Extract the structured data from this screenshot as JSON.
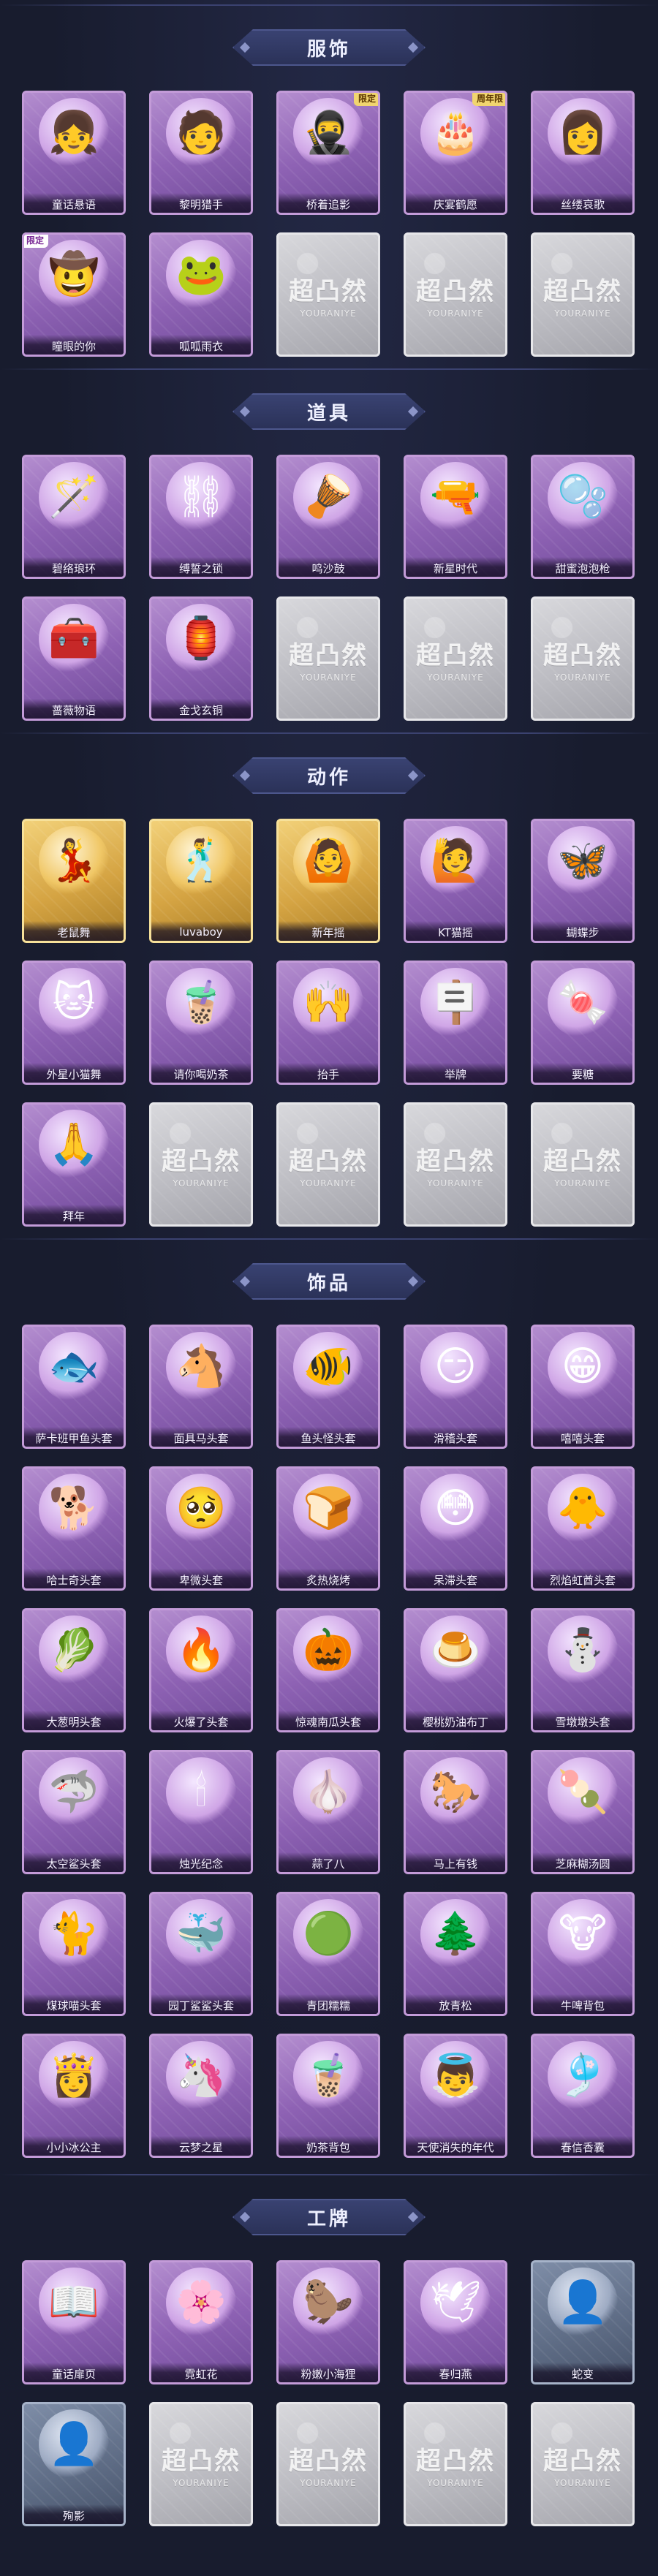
{
  "locked_watermark": {
    "title": "超凸然",
    "subtitle": "YOURANIYE"
  },
  "sections": [
    {
      "title": "服饰",
      "items": [
        {
          "label": "童话悬语",
          "style": "purple",
          "icon": "portrait-girl-icon",
          "glyph": "👧"
        },
        {
          "label": "黎明猎手",
          "style": "purple",
          "icon": "portrait-hunter-icon",
          "glyph": "🧑"
        },
        {
          "label": "桥着追影",
          "style": "purple",
          "icon": "portrait-ninja-icon",
          "glyph": "🥷",
          "badge": "限定"
        },
        {
          "label": "庆宴鹤愿",
          "style": "purple",
          "icon": "portrait-feast-icon",
          "glyph": "🎂",
          "badge": "周年限"
        },
        {
          "label": "丝缕哀歌",
          "style": "purple",
          "icon": "portrait-lady-icon",
          "glyph": "👩"
        },
        {
          "label": "瞳眼的你",
          "style": "purple",
          "icon": "portrait-cowboy-icon",
          "glyph": "🤠",
          "badge_left": "限定"
        },
        {
          "label": "呱呱雨衣",
          "style": "purple",
          "icon": "portrait-frog-girl-icon",
          "glyph": "🐸"
        },
        {
          "label": "",
          "style": "gray",
          "icon": "locked-icon"
        },
        {
          "label": "",
          "style": "gray",
          "icon": "locked-icon"
        },
        {
          "label": "",
          "style": "gray",
          "icon": "locked-icon"
        }
      ]
    },
    {
      "title": "道具",
      "items": [
        {
          "label": "碧络琅环",
          "style": "purple",
          "icon": "staff-icon",
          "glyph": "🪄"
        },
        {
          "label": "缚誓之锁",
          "style": "purple",
          "icon": "chain-icon",
          "glyph": "⛓"
        },
        {
          "label": "鸣沙鼓",
          "style": "purple",
          "icon": "drum-icon",
          "glyph": "🪘"
        },
        {
          "label": "新星时代",
          "style": "purple",
          "icon": "revolver-icon",
          "glyph": "🔫"
        },
        {
          "label": "甜蜜泡泡枪",
          "style": "purple",
          "icon": "bubble-gun-icon",
          "glyph": "🫧"
        },
        {
          "label": "蔷薇物语",
          "style": "purple",
          "icon": "medkit-icon",
          "glyph": "🧰"
        },
        {
          "label": "金戈玄铜",
          "style": "purple",
          "icon": "lantern-icon",
          "glyph": "🏮"
        },
        {
          "label": "",
          "style": "gray",
          "icon": "locked-icon"
        },
        {
          "label": "",
          "style": "gray",
          "icon": "locked-icon"
        },
        {
          "label": "",
          "style": "gray",
          "icon": "locked-icon"
        }
      ]
    },
    {
      "title": "动作",
      "items": [
        {
          "label": "老鼠舞",
          "style": "gold",
          "icon": "dance-pose-icon",
          "glyph": "💃"
        },
        {
          "label": "luvaboy",
          "style": "gold",
          "icon": "dance-pose-icon",
          "glyph": "🕺"
        },
        {
          "label": "新年摇",
          "style": "gold",
          "icon": "dance-pose-icon",
          "glyph": "🙆"
        },
        {
          "label": "KT猫摇",
          "style": "purple",
          "icon": "pose-icon",
          "glyph": "🙋"
        },
        {
          "label": "蝴蝶步",
          "style": "purple",
          "icon": "pose-icon",
          "glyph": "🦋"
        },
        {
          "label": "外星小猫舞",
          "style": "purple",
          "icon": "pose-icon",
          "glyph": "🐱"
        },
        {
          "label": "请你喝奶茶",
          "style": "purple",
          "icon": "pose-icon",
          "glyph": "🧋"
        },
        {
          "label": "抬手",
          "style": "purple",
          "icon": "pose-icon",
          "glyph": "🙌"
        },
        {
          "label": "举牌",
          "style": "purple",
          "icon": "pose-icon",
          "glyph": "🪧"
        },
        {
          "label": "要糖",
          "style": "purple",
          "icon": "pose-icon",
          "glyph": "🍬"
        },
        {
          "label": "拜年",
          "style": "purple",
          "icon": "pose-icon",
          "glyph": "🙏"
        },
        {
          "label": "",
          "style": "gray",
          "icon": "locked-icon"
        },
        {
          "label": "",
          "style": "gray",
          "icon": "locked-icon"
        },
        {
          "label": "",
          "style": "gray",
          "icon": "locked-icon"
        },
        {
          "label": "",
          "style": "gray",
          "icon": "locked-icon"
        }
      ]
    },
    {
      "title": "饰品",
      "items": [
        {
          "label": "萨卡班甲鱼头套",
          "style": "purple",
          "icon": "fish-head-icon",
          "glyph": "🐟"
        },
        {
          "label": "面具马头套",
          "style": "purple",
          "icon": "horse-head-icon",
          "glyph": "🐴"
        },
        {
          "label": "鱼头怪头套",
          "style": "purple",
          "icon": "fish-monster-icon",
          "glyph": "🐠"
        },
        {
          "label": "滑稽头套",
          "style": "purple",
          "icon": "smile-head-icon",
          "glyph": "😏"
        },
        {
          "label": "嘻嘻头套",
          "style": "purple",
          "icon": "grin-head-icon",
          "glyph": "😁"
        },
        {
          "label": "哈士奇头套",
          "style": "purple",
          "icon": "dog-head-icon",
          "glyph": "🐕"
        },
        {
          "label": "卑微头套",
          "style": "purple",
          "icon": "shy-head-icon",
          "glyph": "🥺"
        },
        {
          "label": "炙热烧烤",
          "style": "purple",
          "icon": "toast-head-icon",
          "glyph": "🍞"
        },
        {
          "label": "呆滞头套",
          "style": "purple",
          "icon": "dazed-head-icon",
          "glyph": "😳"
        },
        {
          "label": "烈焰虹酋头套",
          "style": "purple",
          "icon": "chick-head-icon",
          "glyph": "🐥"
        },
        {
          "label": "大葱明头套",
          "style": "purple",
          "icon": "sprout-head-icon",
          "glyph": "🥬"
        },
        {
          "label": "火爆了头套",
          "style": "purple",
          "icon": "flame-head-icon",
          "glyph": "🔥"
        },
        {
          "label": "惊魂南瓜头套",
          "style": "purple",
          "icon": "pumpkin-head-icon",
          "glyph": "🎃"
        },
        {
          "label": "樱桃奶油布丁",
          "style": "purple",
          "icon": "pudding-head-icon",
          "glyph": "🍮"
        },
        {
          "label": "雪墩墩头套",
          "style": "purple",
          "icon": "snowman-head-icon",
          "glyph": "⛄"
        },
        {
          "label": "太空鲨头套",
          "style": "purple",
          "icon": "shark-head-icon",
          "glyph": "🦈"
        },
        {
          "label": "烛光纪念",
          "style": "purple",
          "icon": "candle-head-icon",
          "glyph": "🕯"
        },
        {
          "label": "蒜了八",
          "style": "purple",
          "icon": "garlic-head-icon",
          "glyph": "🧄"
        },
        {
          "label": "马上有钱",
          "style": "purple",
          "icon": "horse-toy-icon",
          "glyph": "🐎"
        },
        {
          "label": "芝麻糊汤圆",
          "style": "purple",
          "icon": "dumpling-head-icon",
          "glyph": "🍡"
        },
        {
          "label": "煤球喵头套",
          "style": "purple",
          "icon": "cat-head-icon",
          "glyph": "🐈"
        },
        {
          "label": "园丁鲨鲨头套",
          "style": "purple",
          "icon": "gardener-shark-icon",
          "glyph": "🐳"
        },
        {
          "label": "青团糯糯",
          "style": "purple",
          "icon": "qingtuan-head-icon",
          "glyph": "🟢"
        },
        {
          "label": "放青松",
          "style": "purple",
          "icon": "pine-tree-icon",
          "glyph": "🌲"
        },
        {
          "label": "牛啤背包",
          "style": "purple",
          "icon": "cow-backpack-icon",
          "glyph": "🐮"
        },
        {
          "label": "小小冰公主",
          "style": "purple",
          "icon": "ice-princess-icon",
          "glyph": "👸"
        },
        {
          "label": "云梦之星",
          "style": "purple",
          "icon": "unicorn-icon",
          "glyph": "🦄"
        },
        {
          "label": "奶茶背包",
          "style": "purple",
          "icon": "milk-tea-backpack-icon",
          "glyph": "🧋"
        },
        {
          "label": "天使消失的年代",
          "style": "purple",
          "icon": "angel-portrait-icon",
          "glyph": "👼"
        },
        {
          "label": "春信香囊",
          "style": "purple",
          "icon": "sachet-icon",
          "glyph": "🎐"
        }
      ]
    },
    {
      "title": "工牌",
      "items": [
        {
          "label": "童话扉页",
          "style": "purple",
          "icon": "storybook-badge-icon",
          "glyph": "📖"
        },
        {
          "label": "霓虹花",
          "style": "purple",
          "icon": "neon-flower-badge-icon",
          "glyph": "🌸"
        },
        {
          "label": "粉嫩小海狸",
          "style": "purple",
          "icon": "beaver-badge-icon",
          "glyph": "🦫"
        },
        {
          "label": "春归燕",
          "style": "purple",
          "icon": "swallow-badge-icon",
          "glyph": "🕊"
        },
        {
          "label": "蛇变",
          "style": "steel",
          "icon": "silhouette-badge-icon",
          "glyph": "👤"
        },
        {
          "label": "殉影",
          "style": "steel",
          "icon": "silhouette-badge-icon",
          "glyph": "👤"
        },
        {
          "label": "",
          "style": "gray",
          "icon": "locked-icon"
        },
        {
          "label": "",
          "style": "gray",
          "icon": "locked-icon"
        },
        {
          "label": "",
          "style": "gray",
          "icon": "locked-icon"
        },
        {
          "label": "",
          "style": "gray",
          "icon": "locked-icon"
        }
      ]
    }
  ]
}
